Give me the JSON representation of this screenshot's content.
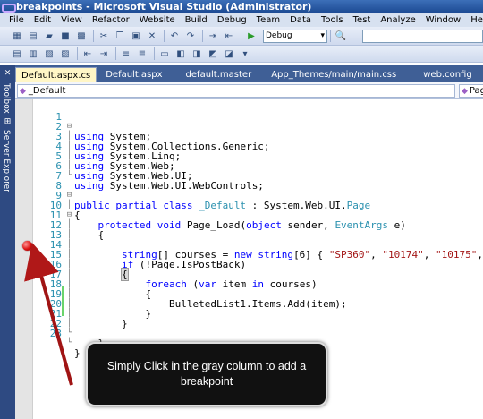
{
  "window": {
    "title": "breakpoints - Microsoft Visual Studio (Administrator)"
  },
  "menu": [
    "File",
    "Edit",
    "View",
    "Refactor",
    "Website",
    "Build",
    "Debug",
    "Team",
    "Data",
    "Tools",
    "Test",
    "Analyze",
    "Window",
    "Help"
  ],
  "toolbar": {
    "configuration": "Debug"
  },
  "side_tabs": {
    "toolbox": "Toolbox",
    "server_explorer": "Server Explorer"
  },
  "doc_tabs": [
    {
      "label": "Default.aspx.cs",
      "active": true
    },
    {
      "label": "Default.aspx",
      "active": false
    },
    {
      "label": "default.master",
      "active": false
    },
    {
      "label": "App_Themes/main/main.css",
      "active": false
    },
    {
      "label": "web.config",
      "active": false
    }
  ],
  "nav": {
    "class_selector": "_Default",
    "member_selector": "Pag"
  },
  "code": [
    {
      "n": "1",
      "text": "using System;"
    },
    {
      "n": "2",
      "text": "using System.Collections.Generic;"
    },
    {
      "n": "3",
      "text": "using System.Linq;"
    },
    {
      "n": "4",
      "text": "using System.Web;"
    },
    {
      "n": "5",
      "text": "using System.Web.UI;"
    },
    {
      "n": "6",
      "text": "using System.Web.UI.WebControls;"
    },
    {
      "n": "7",
      "text": ""
    },
    {
      "n": "8",
      "text": "public partial class _Default : System.Web.UI.Page"
    },
    {
      "n": "9",
      "text": "{"
    },
    {
      "n": "10",
      "text": "    protected void Page_Load(object sender, EventArgs e)"
    },
    {
      "n": "11",
      "text": "    {"
    },
    {
      "n": "12",
      "text": ""
    },
    {
      "n": "13",
      "text": "        string[] courses = new string[6] { \"SP360\", \"10174\", \"10175\", \"S"
    },
    {
      "n": "14",
      "text": "        if (!Page.IsPostBack)"
    },
    {
      "n": "15",
      "text": "        {"
    },
    {
      "n": "16",
      "text": "            foreach (var item in courses)"
    },
    {
      "n": "17",
      "text": "            {"
    },
    {
      "n": "18",
      "text": "                BulletedList1.Items.Add(item);"
    },
    {
      "n": "19",
      "text": "            }"
    },
    {
      "n": "20",
      "text": "        }"
    },
    {
      "n": "21",
      "text": ""
    },
    {
      "n": "22",
      "text": "    }"
    },
    {
      "n": "23",
      "text": "}"
    }
  ],
  "callout": {
    "text": "Simply Click in the gray column to add a breakpoint"
  }
}
